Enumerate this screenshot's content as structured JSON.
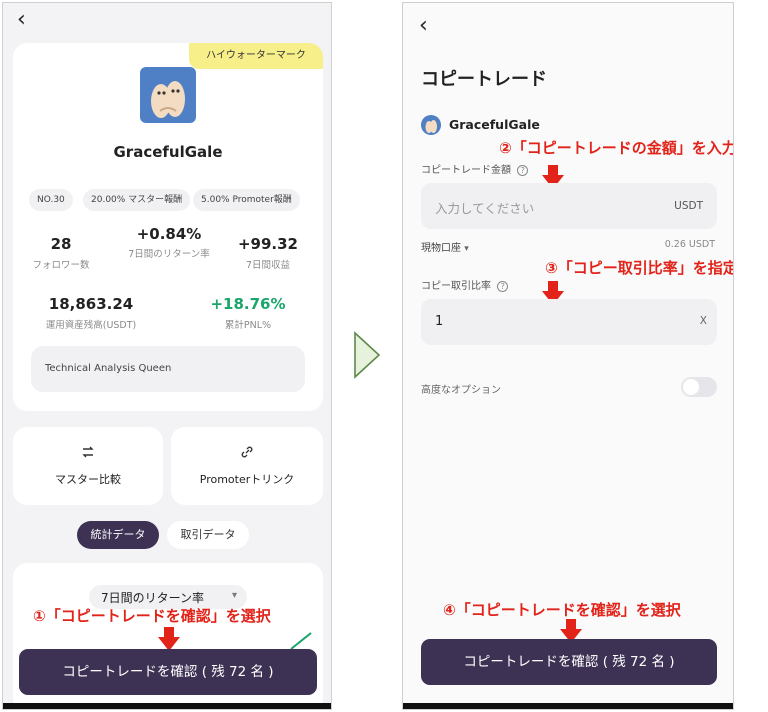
{
  "left": {
    "back_icon": "‹",
    "high_water_badge": "ハイウォーターマーク",
    "trader_name": "GracefulGale",
    "chips": [
      "NO.30",
      "20.00% マスター報酬",
      "5.00% Promoter報酬"
    ],
    "stats": [
      {
        "value": "28",
        "label": "フォロワー数"
      },
      {
        "value": "+0.84%",
        "label": "7日間のリターン率"
      },
      {
        "value": "+99.32",
        "label": "7日間収益"
      },
      {
        "value": "18,863.24",
        "label": "運用資産残高(USDT)"
      },
      {
        "value": "+18.76%",
        "label": "累計PNL%"
      }
    ],
    "bio": "Technical Analysis Queen",
    "actions": [
      {
        "icon": "swap-icon",
        "label": "マスター比較"
      },
      {
        "icon": "link-icon",
        "label": "Promoterトリンク"
      }
    ],
    "tabs": [
      "統計データ",
      "取引データ"
    ],
    "period_select": "7日間のリターン率",
    "annotation": "①「コピートレードを確認」を選択",
    "cta": "コピートレードを確認 ( 残 72 名 )"
  },
  "divider_arrow": "play-arrow-icon",
  "right": {
    "back_icon": "‹",
    "page_title": "コピートレード",
    "trader_name": "GracefulGale",
    "annotation_2": "②「コピートレードの金額」を入力",
    "amount_label": "コピートレード金額",
    "amount_placeholder": "入力してください",
    "amount_unit": "USDT",
    "account_select": "現物口座",
    "account_balance": "0.26 USDT",
    "annotation_3": "③「コピー取引比率」を指定",
    "ratio_label": "コピー取引比率",
    "ratio_value": "1",
    "ratio_unit": "X",
    "advanced_label": "高度なオプション",
    "advanced_enabled": false,
    "annotation_4": "④「コピートレードを確認」を選択",
    "cta": "コピートレードを確認 ( 残 72 名 )"
  },
  "colors": {
    "cta_bg": "#3d3254",
    "annotation_red": "#e2231a",
    "positive_green": "#1aa56a",
    "badge_yellow": "#f7ef8a",
    "avatar_blue": "#4f7fc4"
  }
}
